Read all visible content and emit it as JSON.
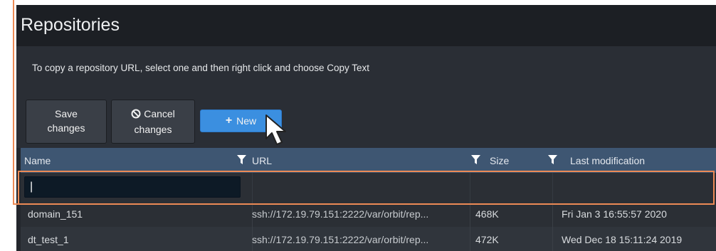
{
  "page": {
    "title": "Repositories",
    "instructions": "To copy a repository URL, select one and then right click and choose Copy Text"
  },
  "toolbar": {
    "save_line1": "Save",
    "save_line2": "changes",
    "cancel_line1": "Cancel",
    "cancel_line2": "changes",
    "new_label": "New"
  },
  "table": {
    "columns": [
      {
        "label": "Name",
        "filter_icon": "filter-icon"
      },
      {
        "label": "URL",
        "filter_icon": "filter-icon"
      },
      {
        "label": "Size",
        "filter_icon": "filter-icon"
      },
      {
        "label": "Last modification"
      }
    ],
    "filter": {
      "name_value": "|"
    },
    "rows": [
      {
        "name": "domain_151",
        "url": "ssh://172.19.79.151:2222/var/orbit/rep...",
        "size": "468K",
        "modified": "Fri Jan 3 16:55:57 2020"
      },
      {
        "name": "dt_test_1",
        "url": "ssh://172.19.79.151:2222/var/orbit/rep...",
        "size": "472K",
        "modified": "Wed Dec 18 15:11:24 2019"
      }
    ]
  },
  "colors": {
    "accent": "#3b8fe0",
    "header": "#3e5672",
    "highlight": "#ec8a55",
    "background": "#23272d"
  }
}
